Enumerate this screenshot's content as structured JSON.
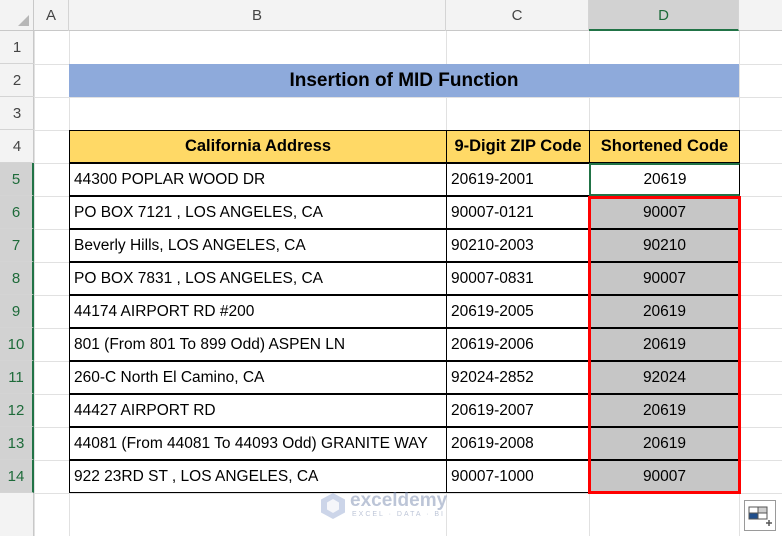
{
  "columns": {
    "a": "A",
    "b": "B",
    "c": "C",
    "d": "D"
  },
  "rows": [
    "1",
    "2",
    "3",
    "4",
    "5",
    "6",
    "7",
    "8",
    "9",
    "10",
    "11",
    "12",
    "13",
    "14"
  ],
  "title": "Insertion of MID Function",
  "table": {
    "headers": [
      "California Address",
      "9-Digit ZIP Code",
      "Shortened Code"
    ],
    "data": [
      {
        "address": "44300 POPLAR WOOD DR",
        "zip": "20619-2001",
        "short": "20619"
      },
      {
        "address": "PO BOX 7121 , LOS ANGELES, CA",
        "zip": "90007-0121",
        "short": "90007"
      },
      {
        "address": "Beverly Hills,  LOS ANGELES, CA",
        "zip": "90210-2003",
        "short": "90210"
      },
      {
        "address": "PO BOX 7831 , LOS ANGELES, CA",
        "zip": "90007-0831",
        "short": "90007"
      },
      {
        "address": "44174 AIRPORT RD #200",
        "zip": "20619-2005",
        "short": "20619"
      },
      {
        "address": "801 (From 801 To 899 Odd) ASPEN LN",
        "zip": "20619-2006",
        "short": "20619"
      },
      {
        "address": "260-C North El Camino, CA",
        "zip": "92024-2852",
        "short": "92024"
      },
      {
        "address": "44427 AIRPORT RD",
        "zip": "20619-2007",
        "short": "20619"
      },
      {
        "address": "44081 (From 44081 To 44093 Odd) GRANITE WAY",
        "zip": "20619-2008",
        "short": "20619"
      },
      {
        "address": "922 23RD ST , LOS ANGELES, CA",
        "zip": "90007-1000",
        "short": "90007"
      }
    ]
  },
  "watermark": {
    "name": "exceldemy",
    "tagline": "EXCEL · DATA · BI"
  },
  "icons": {
    "paste_options": "paste-options-icon",
    "select_all": "select-all-icon"
  },
  "colors": {
    "title_fill": "#8eaadb",
    "header_fill": "#ffd966",
    "highlight_fill": "#c6c6c6",
    "selection_border": "#ff0000",
    "active_border": "#217346"
  }
}
